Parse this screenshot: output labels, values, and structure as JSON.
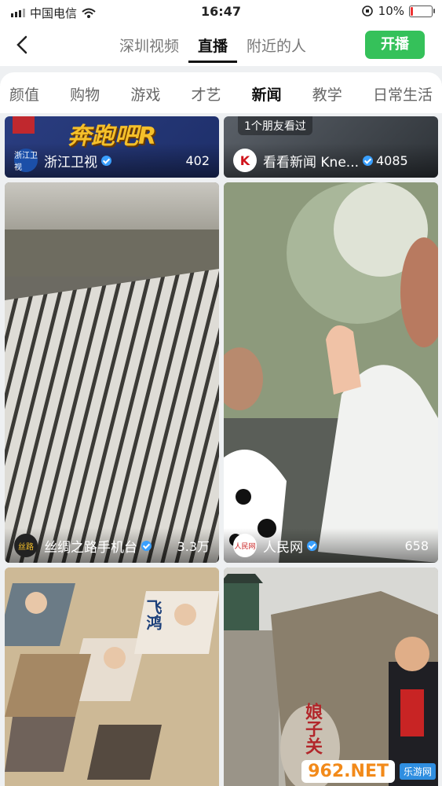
{
  "status": {
    "carrier": "中国电信",
    "time": "16:47",
    "battery": "10%"
  },
  "nav": {
    "tabs": [
      "深圳视频",
      "直播",
      "附近的人"
    ],
    "active_tab": "直播",
    "go_live_label": "开播"
  },
  "categories": {
    "items": [
      "颜值",
      "购物",
      "游戏",
      "才艺",
      "新闻",
      "教学",
      "日常生活"
    ],
    "active": "新闻"
  },
  "cards": [
    {
      "name": "浙江卫视",
      "avatar_text": "浙江卫视",
      "viewers": "402",
      "verified": true,
      "banner_text": "奔跑吧R"
    },
    {
      "name": "看看新闻 Kne...",
      "avatar_text": "K",
      "viewers": "4085",
      "verified": true,
      "friend_tag": "1个朋友看过"
    },
    {
      "name": "丝绸之路手机台",
      "avatar_text": "丝路",
      "viewers": "3.3万",
      "verified": true
    },
    {
      "name": "人民网",
      "avatar_text": "人民网",
      "viewers": "658",
      "verified": true
    },
    {
      "name": "",
      "avatar_text": "",
      "viewers": "",
      "verified": false,
      "poster_text": "飞鸿"
    },
    {
      "name": "",
      "avatar_text": "",
      "viewers": "",
      "verified": false,
      "rock_text": "娘子关"
    }
  ],
  "watermark": {
    "brand": "962.NET",
    "sub": "乐游网"
  },
  "colors": {
    "accent_green": "#35c15a",
    "verify_blue": "#3aa0ff"
  }
}
